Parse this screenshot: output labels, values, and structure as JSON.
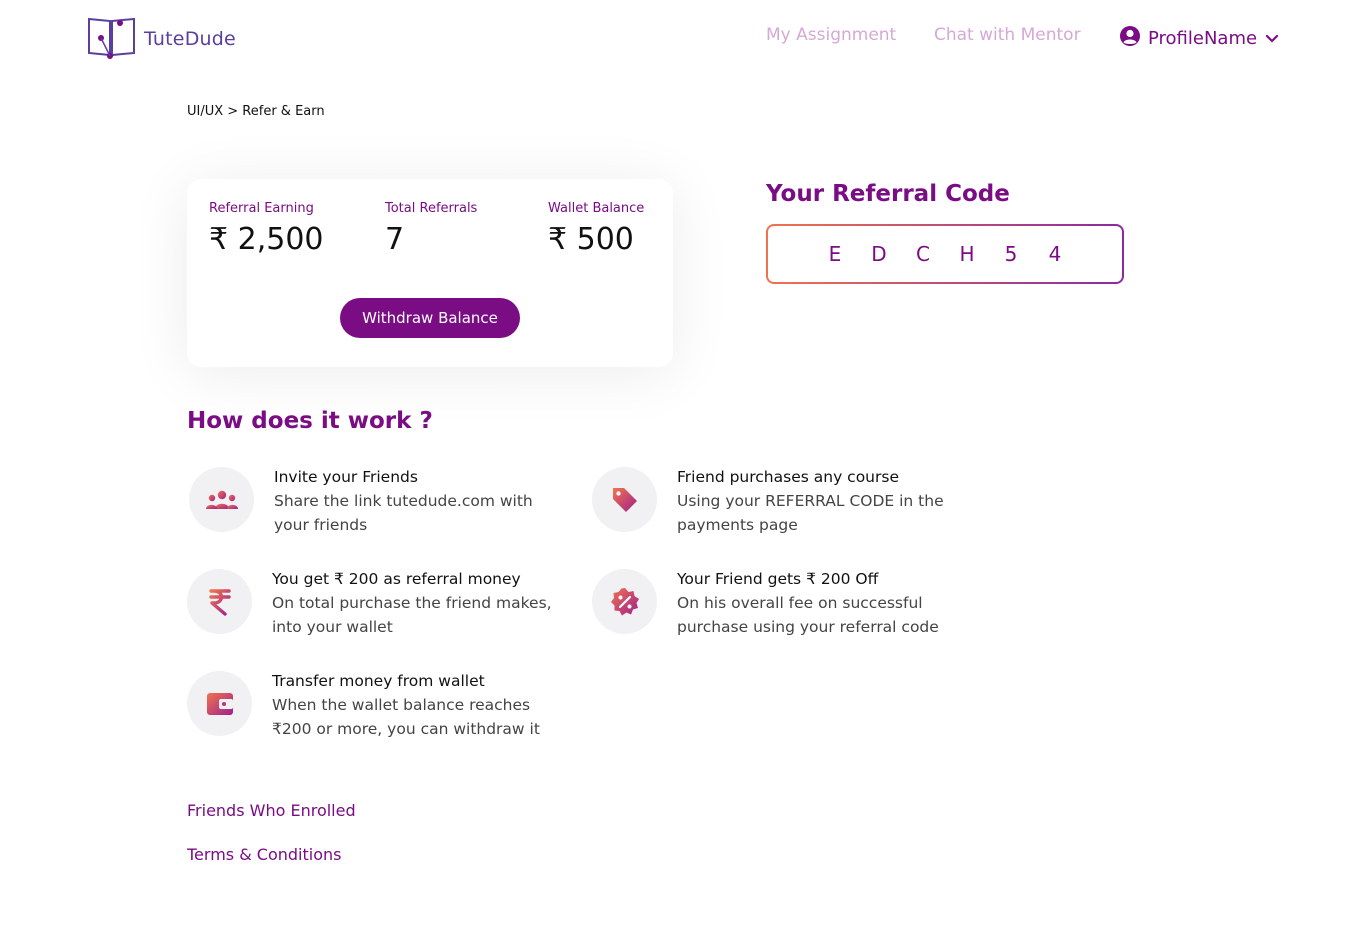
{
  "header": {
    "logo_text": "TuteDude",
    "nav": {
      "assignment": "My Assignment",
      "chat": "Chat with Mentor"
    },
    "profile_name": "ProfileName"
  },
  "breadcrumb": "UI/UX > Refer & Earn",
  "stats": {
    "earning_label": "Referral Earning",
    "earning_value": "₹ 2,500",
    "referrals_label": "Total Referrals",
    "referrals_value": "7",
    "wallet_label": "Wallet Balance",
    "wallet_value": "₹ 500",
    "withdraw_button": "Withdraw Balance"
  },
  "referral": {
    "title": "Your Referral Code",
    "code": [
      "E",
      "D",
      "C",
      "H",
      "5",
      "4"
    ]
  },
  "how_it_works": {
    "title": "How does it work ?",
    "steps": [
      {
        "icon": "people-icon",
        "title": "Invite your Friends",
        "desc": "Share the link tutedude.com with your friends"
      },
      {
        "icon": "tag-icon",
        "title": "Friend purchases any course",
        "desc": "Using your REFERRAL CODE in the payments page"
      },
      {
        "icon": "rupee-icon",
        "title": "You get ₹ 200 as referral money",
        "desc": "On total purchase the friend makes, into your wallet"
      },
      {
        "icon": "discount-badge-icon",
        "title": "Your Friend gets ₹ 200 Off",
        "desc": "On his overall fee on successful purchase using your referral code"
      },
      {
        "icon": "wallet-icon",
        "title": "Transfer money from wallet",
        "desc": "When the wallet balance reaches ₹200 or more, you can withdraw it"
      }
    ]
  },
  "links": {
    "friends": "Friends Who Enrolled",
    "terms": "Terms & Conditions"
  },
  "colors": {
    "brand": "#7a0c84",
    "nav_muted": "#d5a9d6",
    "gradient_start": "#f0734e",
    "gradient_end": "#8a2aa0"
  }
}
